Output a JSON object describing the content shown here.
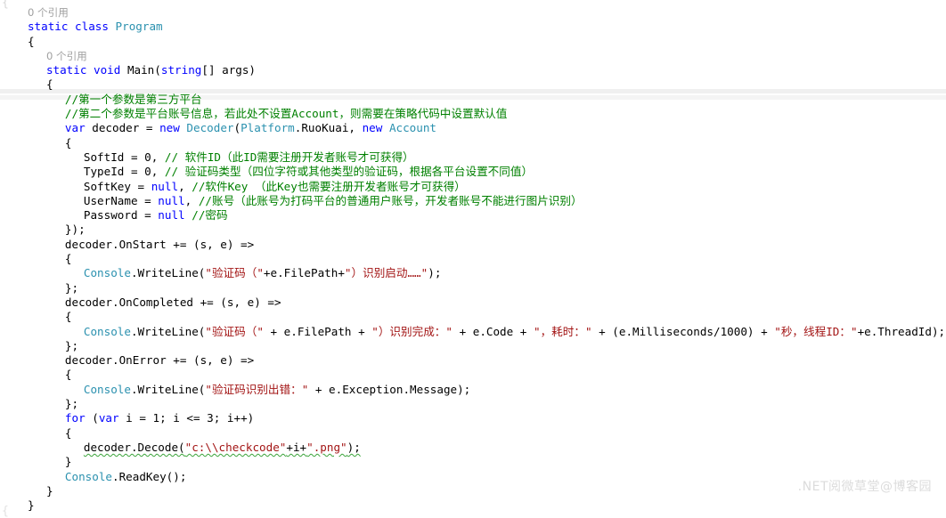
{
  "editor": {
    "language": "csharp",
    "colors": {
      "background": "#ffffff",
      "keyword": "#0000ff",
      "type": "#2b91af",
      "string": "#a31515",
      "comment": "#008000",
      "plain": "#000000",
      "codelens": "#a0a0a0",
      "band": "#f2f2f2",
      "watermark": "#dcdcdc",
      "squiggle": "#3aa33a"
    },
    "stray_glyph_top": "{",
    "stray_glyph_bottom": "{"
  },
  "codelens": {
    "class_refs": "0 个引用",
    "method_refs": "0 个引用"
  },
  "watermark": {
    "text": ".NET阅微草堂@博客园"
  },
  "code": {
    "lines": [
      {
        "indent": 2,
        "tokens": [
          {
            "t": "0 个引用",
            "c": "codelens"
          }
        ]
      },
      {
        "indent": 2,
        "tokens": [
          {
            "t": "static class ",
            "c": "kw"
          },
          {
            "t": "Program",
            "c": "type"
          }
        ]
      },
      {
        "indent": 2,
        "tokens": [
          {
            "t": "{",
            "c": "plain"
          }
        ]
      },
      {
        "indent": 4,
        "tokens": [
          {
            "t": "0 个引用",
            "c": "codelens"
          }
        ]
      },
      {
        "indent": 4,
        "tokens": [
          {
            "t": "static void ",
            "c": "kw"
          },
          {
            "t": "Main(",
            "c": "plain"
          },
          {
            "t": "string",
            "c": "kw"
          },
          {
            "t": "[] args)",
            "c": "plain"
          }
        ]
      },
      {
        "indent": 4,
        "tokens": [
          {
            "t": "{",
            "c": "plain"
          }
        ]
      },
      {
        "indent": 6,
        "tokens": [
          {
            "t": "//第一个参数是第三方平台",
            "c": "cmt"
          }
        ]
      },
      {
        "indent": 6,
        "tokens": [
          {
            "t": "//第二个参数是平台账号信息，若此处不设置Account，则需要在策略代码中设置默认值",
            "c": "cmt"
          }
        ]
      },
      {
        "indent": 6,
        "tokens": [
          {
            "t": "var",
            "c": "kw"
          },
          {
            "t": " decoder = ",
            "c": "plain"
          },
          {
            "t": "new",
            "c": "kw"
          },
          {
            "t": " ",
            "c": "plain"
          },
          {
            "t": "Decoder",
            "c": "type"
          },
          {
            "t": "(",
            "c": "plain"
          },
          {
            "t": "Platform",
            "c": "type"
          },
          {
            "t": ".RuoKuai, ",
            "c": "plain"
          },
          {
            "t": "new",
            "c": "kw"
          },
          {
            "t": " ",
            "c": "plain"
          },
          {
            "t": "Account",
            "c": "type"
          }
        ]
      },
      {
        "indent": 6,
        "tokens": [
          {
            "t": "{",
            "c": "plain"
          }
        ]
      },
      {
        "indent": 8,
        "tokens": [
          {
            "t": "SoftId = 0, ",
            "c": "plain"
          },
          {
            "t": "// 软件ID（此ID需要注册开发者账号才可获得）",
            "c": "cmt"
          }
        ]
      },
      {
        "indent": 8,
        "tokens": [
          {
            "t": "TypeId = 0, ",
            "c": "plain"
          },
          {
            "t": "// 验证码类型（四位字符或其他类型的验证码，根据各平台设置不同值）",
            "c": "cmt"
          }
        ]
      },
      {
        "indent": 8,
        "tokens": [
          {
            "t": "SoftKey = ",
            "c": "plain"
          },
          {
            "t": "null",
            "c": "kw"
          },
          {
            "t": ", ",
            "c": "plain"
          },
          {
            "t": "//软件Key （此Key也需要注册开发者账号才可获得）",
            "c": "cmt"
          }
        ]
      },
      {
        "indent": 8,
        "tokens": [
          {
            "t": "UserName = ",
            "c": "plain"
          },
          {
            "t": "null",
            "c": "kw"
          },
          {
            "t": ", ",
            "c": "plain"
          },
          {
            "t": "//账号（此账号为打码平台的普通用户账号，开发者账号不能进行图片识别）",
            "c": "cmt"
          }
        ]
      },
      {
        "indent": 8,
        "tokens": [
          {
            "t": "Password = ",
            "c": "plain"
          },
          {
            "t": "null",
            "c": "kw"
          },
          {
            "t": " ",
            "c": "plain"
          },
          {
            "t": "//密码",
            "c": "cmt"
          }
        ]
      },
      {
        "indent": 6,
        "tokens": [
          {
            "t": "});",
            "c": "plain"
          }
        ]
      },
      {
        "indent": 6,
        "tokens": [
          {
            "t": "decoder.OnStart += (s, e) =>",
            "c": "plain"
          }
        ]
      },
      {
        "indent": 6,
        "tokens": [
          {
            "t": "{",
            "c": "plain"
          }
        ]
      },
      {
        "indent": 8,
        "tokens": [
          {
            "t": "Console",
            "c": "type"
          },
          {
            "t": ".WriteLine(",
            "c": "plain"
          },
          {
            "t": "\"验证码（\"",
            "c": "str"
          },
          {
            "t": "+e.FilePath+",
            "c": "plain"
          },
          {
            "t": "\"）识别启动……\"",
            "c": "str"
          },
          {
            "t": ");",
            "c": "plain"
          }
        ]
      },
      {
        "indent": 6,
        "tokens": [
          {
            "t": "};",
            "c": "plain"
          }
        ]
      },
      {
        "indent": 6,
        "tokens": [
          {
            "t": "decoder.OnCompleted += (s, e) =>",
            "c": "plain"
          }
        ]
      },
      {
        "indent": 6,
        "tokens": [
          {
            "t": "{",
            "c": "plain"
          }
        ]
      },
      {
        "indent": 8,
        "tokens": [
          {
            "t": "Console",
            "c": "type"
          },
          {
            "t": ".WriteLine(",
            "c": "plain"
          },
          {
            "t": "\"验证码（\"",
            "c": "str"
          },
          {
            "t": " + e.FilePath + ",
            "c": "plain"
          },
          {
            "t": "\"）识别完成：\"",
            "c": "str"
          },
          {
            "t": " + e.Code + ",
            "c": "plain"
          },
          {
            "t": "\"，耗时：\"",
            "c": "str"
          },
          {
            "t": " + (e.Milliseconds/1000) + ",
            "c": "plain"
          },
          {
            "t": "\"秒，线程ID：\"",
            "c": "str"
          },
          {
            "t": "+e.ThreadId);",
            "c": "plain"
          }
        ]
      },
      {
        "indent": 6,
        "tokens": [
          {
            "t": "};",
            "c": "plain"
          }
        ]
      },
      {
        "indent": 6,
        "tokens": [
          {
            "t": "decoder.OnError += (s, e) =>",
            "c": "plain"
          }
        ]
      },
      {
        "indent": 6,
        "tokens": [
          {
            "t": "{",
            "c": "plain"
          }
        ]
      },
      {
        "indent": 8,
        "tokens": [
          {
            "t": "Console",
            "c": "type"
          },
          {
            "t": ".WriteLine(",
            "c": "plain"
          },
          {
            "t": "\"验证码识别出错：\"",
            "c": "str"
          },
          {
            "t": " + e.Exception.Message);",
            "c": "plain"
          }
        ]
      },
      {
        "indent": 6,
        "tokens": [
          {
            "t": "};",
            "c": "plain"
          }
        ]
      },
      {
        "indent": 6,
        "tokens": [
          {
            "t": "for",
            "c": "kw"
          },
          {
            "t": " (",
            "c": "plain"
          },
          {
            "t": "var",
            "c": "kw"
          },
          {
            "t": " i = 1; i <= 3; i++)",
            "c": "plain"
          }
        ]
      },
      {
        "indent": 6,
        "tokens": [
          {
            "t": "{",
            "c": "plain"
          }
        ]
      },
      {
        "indent": 8,
        "squiggle": true,
        "tokens": [
          {
            "t": "decoder.Decode(",
            "c": "plain"
          },
          {
            "t": "\"c:\\\\checkcode\"",
            "c": "str"
          },
          {
            "t": "+i+",
            "c": "plain"
          },
          {
            "t": "\".png\"",
            "c": "str"
          },
          {
            "t": ");",
            "c": "plain"
          }
        ]
      },
      {
        "indent": 6,
        "tokens": [
          {
            "t": "}",
            "c": "plain"
          }
        ]
      },
      {
        "indent": 6,
        "tokens": [
          {
            "t": "Console",
            "c": "type"
          },
          {
            "t": ".ReadKey();",
            "c": "plain"
          }
        ]
      },
      {
        "indent": 4,
        "tokens": [
          {
            "t": "}",
            "c": "plain"
          }
        ]
      },
      {
        "indent": 2,
        "tokens": [
          {
            "t": "}",
            "c": "plain"
          }
        ]
      }
    ]
  }
}
